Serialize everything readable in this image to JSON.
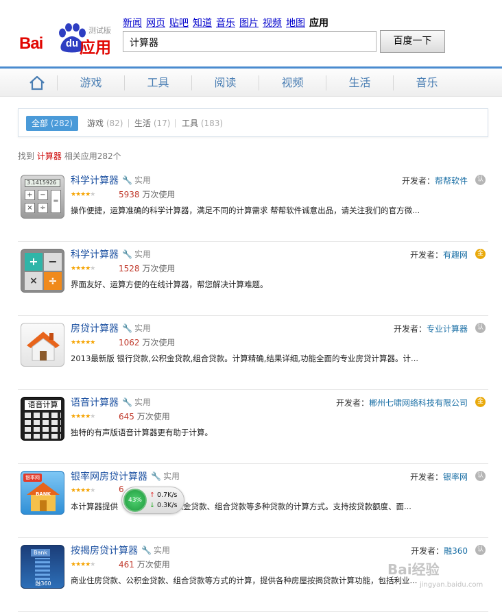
{
  "logo": {
    "bai": "Bai",
    "du": "du",
    "yingyong": "应用",
    "beta": "测试版"
  },
  "topnav": [
    "新闻",
    "网页",
    "贴吧",
    "知道",
    "音乐",
    "图片",
    "视频",
    "地图",
    "应用"
  ],
  "search": {
    "value": "计算器",
    "button": "百度一下"
  },
  "categories": [
    "游戏",
    "工具",
    "阅读",
    "视频",
    "生活",
    "音乐"
  ],
  "filters": {
    "all": {
      "label": "全部",
      "count": "(282)"
    },
    "items": [
      {
        "label": "游戏",
        "count": "(82)"
      },
      {
        "label": "生活",
        "count": "(17)"
      },
      {
        "label": "工具",
        "count": "(183)"
      }
    ]
  },
  "found": {
    "prefix": "找到",
    "keyword": "计算器",
    "suffix": "相关应用282个"
  },
  "apps": [
    {
      "name": "科学计算器",
      "tag": "实用",
      "uses": "5938",
      "unit": "万次使用",
      "desc": "操作便捷，运算准确的科学计算器，满足不同的计算需求 帮帮软件诚意出品，请关注我们的官方微...",
      "dev_label": "开发者：",
      "dev": "帮帮软件",
      "badge": "grey",
      "stars": 4
    },
    {
      "name": "科学计算器",
      "tag": "实用",
      "uses": "1528",
      "unit": "万次使用",
      "desc": "界面友好、运算方便的在线计算器，帮您解决计算难题。",
      "dev_label": "开发者：",
      "dev": "有趣网",
      "badge": "gold",
      "stars": 4
    },
    {
      "name": "房贷计算器",
      "tag": "实用",
      "uses": "1062",
      "unit": "万次使用",
      "desc": "2013最新版 银行贷款,公积金贷款,组合贷款。计算精确,结果详细,功能全面的专业房贷计算器。计...",
      "dev_label": "开发者：",
      "dev": "专业计算器",
      "badge": "grey",
      "stars": 5
    },
    {
      "name": "语音计算器",
      "tag": "实用",
      "uses": "645",
      "unit": "万次使用",
      "desc": "独特的有声版语音计算器更有助于计算。",
      "dev_label": "开发者：",
      "dev": "郴州七啸网络科技有限公司",
      "badge": "gold",
      "stars": 4
    },
    {
      "name": "银率网房贷计算器",
      "tag": "实用",
      "uses": "6",
      "unit": "",
      "desc": "本计算器提供",
      "desc2": "公积金贷款、组合贷款等多种贷款的计算方式。支持按贷款额度、面...",
      "dev_label": "开发者：",
      "dev": "银率网",
      "badge": "grey",
      "stars": 4
    },
    {
      "name": "按揭房贷计算器",
      "tag": "实用",
      "uses": "461",
      "unit": "万次使用",
      "desc": "商业住房贷款、公积金贷款、组合贷款等方式的计算，提供各种房屋按揭贷款计算功能，包括利业...",
      "dev_label": "开发者：",
      "dev": "融360",
      "badge": "grey",
      "stars": 4
    }
  ],
  "icons": {
    "calc1": "3.1415926",
    "voice": "语音计算",
    "bank": "BANK",
    "yinlv": "银率网",
    "rong": "融360",
    "bank2": "Bank"
  },
  "speed": {
    "pct": "43%",
    "up": "0.7K/s",
    "down": "0.3K/s"
  },
  "watermark": {
    "text": "Bai经验",
    "sub": "jingyan.baidu.com"
  }
}
